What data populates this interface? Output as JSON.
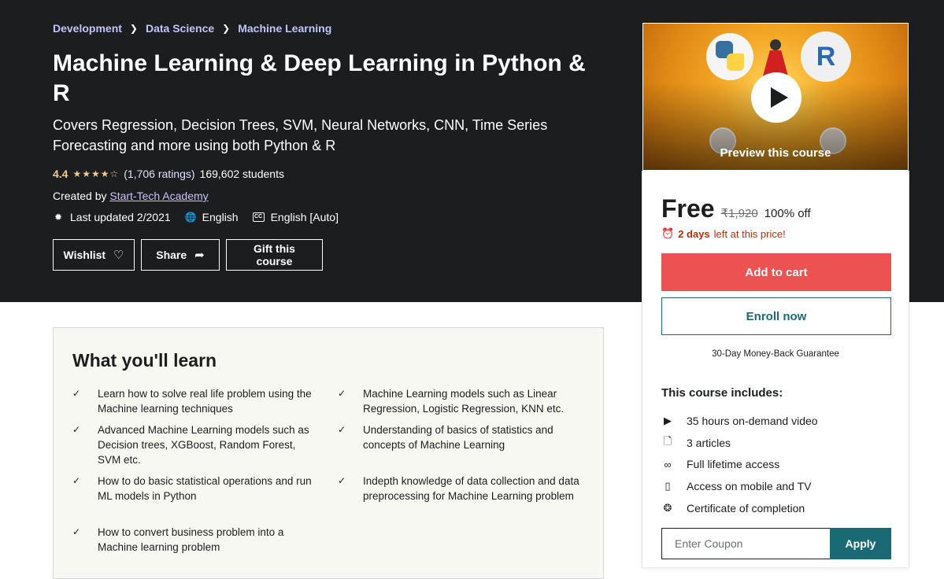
{
  "breadcrumb": [
    "Development",
    "Data Science",
    "Machine Learning"
  ],
  "course": {
    "title": "Machine Learning & Deep Learning in Python & R",
    "subtitle": "Covers Regression, Decision Trees, SVM, Neural Networks, CNN, Time Series Forecasting and more using both Python & R",
    "rating": "4.4",
    "rating_stars": 4.4,
    "ratings_count": "(1,706 ratings)",
    "students": "169,602 students",
    "created_by_label": "Created by",
    "instructor": "Start-Tech Academy",
    "last_updated": "Last updated 2/2021",
    "language": "English",
    "captions": "English [Auto]"
  },
  "actions": {
    "wishlist": "Wishlist",
    "share": "Share",
    "gift": "Gift this course"
  },
  "preview": {
    "label": "Preview this course",
    "logo_r": "R"
  },
  "purchase": {
    "price": "Free",
    "original_price": "₹1,920",
    "discount": "100% off",
    "deadline_bold": "2 days",
    "deadline_rest": "left at this price!",
    "add_to_cart": "Add to cart",
    "enroll": "Enroll now",
    "guarantee": "30-Day Money-Back Guarantee",
    "includes_title": "This course includes:",
    "includes": [
      {
        "icon": "video-icon",
        "text": "35 hours on-demand video"
      },
      {
        "icon": "file-icon",
        "text": "3 articles"
      },
      {
        "icon": "infinity-icon",
        "text": "Full lifetime access"
      },
      {
        "icon": "mobile-icon",
        "text": "Access on mobile and TV"
      },
      {
        "icon": "certificate-icon",
        "text": "Certificate of completion"
      }
    ],
    "coupon_placeholder": "Enter Coupon",
    "apply": "Apply"
  },
  "learn": {
    "title": "What you'll learn",
    "left": [
      "Learn how to solve real life problem using the Machine learning techniques",
      "Advanced Machine Learning models such as Decision trees, XGBoost, Random Forest, SVM etc.",
      "How to do basic statistical operations and run ML models in Python",
      "How to convert business problem into a Machine learning problem"
    ],
    "right": [
      "Machine Learning models such as Linear Regression, Logistic Regression, KNN etc.",
      "Understanding of basics of statistics and concepts of Machine Learning",
      "Indepth knowledge of data collection and data preprocessing for Machine Learning problem"
    ]
  },
  "colors": {
    "hero_bg": "#1c1d1f",
    "star": "#f3ca8c",
    "cart_button": "#ec5252",
    "teal": "#1a6a75",
    "deadline": "#b32d0f"
  }
}
